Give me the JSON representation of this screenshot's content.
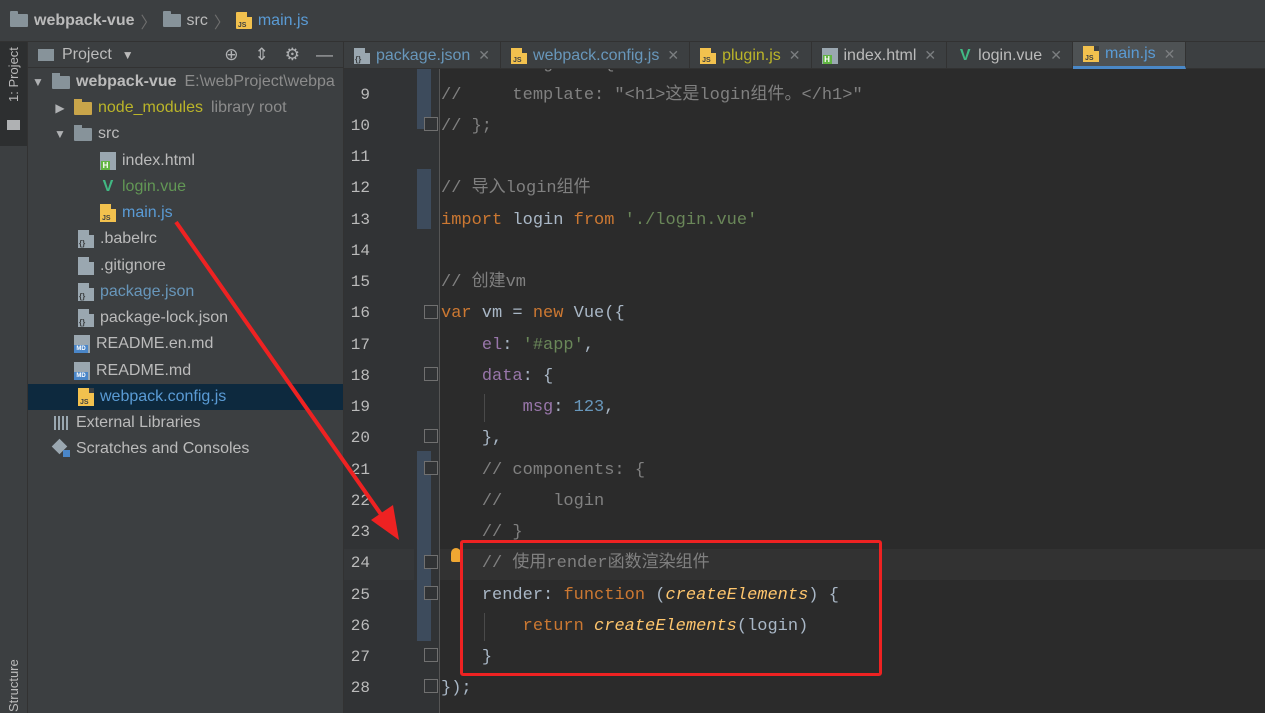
{
  "breadcrumb": {
    "project": "webpack-vue",
    "folder": "src",
    "file": "main.js"
  },
  "left_strip": {
    "project_tab": "1: Project",
    "structure_tab": "Structure"
  },
  "project_panel": {
    "title": "Project",
    "tree": {
      "root": {
        "name": "webpack-vue",
        "path": "E:\\webProject\\webpa"
      },
      "node_modules": {
        "name": "node_modules",
        "suffix": "library root"
      },
      "src": "src",
      "index_html": "index.html",
      "login_vue": "login.vue",
      "main_js": "main.js",
      "babelrc": ".babelrc",
      "gitignore": ".gitignore",
      "package_json": "package.json",
      "package_lock": "package-lock.json",
      "readme_en": "README.en.md",
      "readme": "README.md",
      "webpack_config": "webpack.config.js",
      "external_libraries": "External Libraries",
      "scratches": "Scratches and Consoles"
    }
  },
  "tabs": [
    {
      "label": "package.json"
    },
    {
      "label": "webpack.config.js"
    },
    {
      "label": "plugin.js"
    },
    {
      "label": "index.html"
    },
    {
      "label": "login.vue"
    },
    {
      "label": "main.js"
    }
  ],
  "editor": {
    "lines": [
      {
        "n": "9"
      },
      {
        "n": "10"
      },
      {
        "n": "11"
      },
      {
        "n": "12"
      },
      {
        "n": "13"
      },
      {
        "n": "14"
      },
      {
        "n": "15"
      },
      {
        "n": "16"
      },
      {
        "n": "17"
      },
      {
        "n": "18"
      },
      {
        "n": "19"
      },
      {
        "n": "20"
      },
      {
        "n": "21"
      },
      {
        "n": "22"
      },
      {
        "n": "23"
      },
      {
        "n": "24"
      },
      {
        "n": "25"
      },
      {
        "n": "26"
      },
      {
        "n": "27"
      },
      {
        "n": "28"
      }
    ],
    "code": {
      "l8": "//  var login = {",
      "l9": "//     template: \"<h1>这是login组件。</h1>\"",
      "l10": "// };",
      "l12": "// 导入login组件",
      "l13_kw1": "import",
      "l13_mid": " login ",
      "l13_kw2": "from",
      "l13_str": " './login.vue'",
      "l15": "// 创建vm",
      "l16_kw1": "var",
      "l16_a": " vm = ",
      "l16_kw2": "new",
      "l16_b": " Vue({",
      "l17_prop": "el",
      "l17_colon": ": ",
      "l17_str": "'#app'",
      "l17_end": ",",
      "l18_prop": "data",
      "l18_end": ": {",
      "l19_prop": "msg",
      "l19_colon": ": ",
      "l19_num": "123",
      "l19_end": ",",
      "l20": "},",
      "l21": "// components: {",
      "l22": "//     login",
      "l23": "// }",
      "l24": "// 使用render函数渲染组件",
      "l25_prop": "render",
      "l25_colon": ": ",
      "l25_kw": "function",
      "l25_a": " (",
      "l25_fn": "createElements",
      "l25_b": ") {",
      "l26_kw": "return",
      "l26_sp": " ",
      "l26_fn": "createElements",
      "l26_b": "(login)",
      "l27": "}",
      "l28": "});"
    }
  },
  "colors": {
    "annotation": "#ee2222",
    "keyword": "#cc7832",
    "string": "#6a8759",
    "comment": "#808080",
    "number": "#6897bb",
    "property": "#9876aa",
    "italic_fn": "#ffc66d"
  }
}
